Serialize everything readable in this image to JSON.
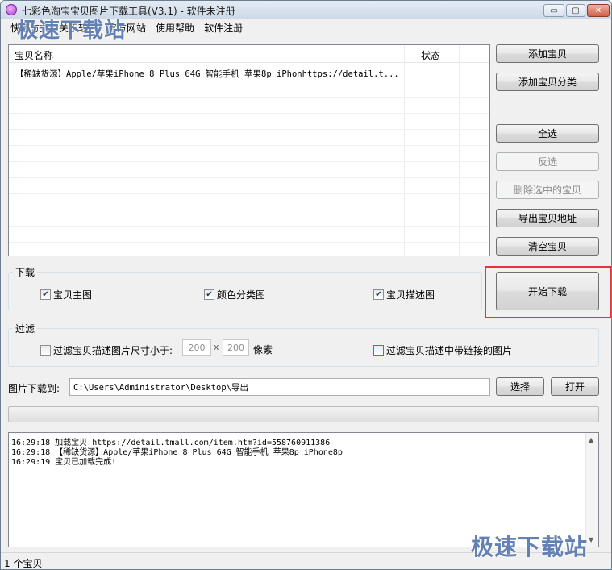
{
  "window": {
    "title": "七彩色淘宝宝贝图片下载工具(V3.1) - 软件未注册",
    "controls": {
      "minimize": "▭",
      "maximize": "▢",
      "close": "✕"
    }
  },
  "menu": {
    "items": [
      "快速方式",
      "关于软件",
      "官方网站",
      "使用帮助",
      "软件注册"
    ]
  },
  "watermark": {
    "top_left": "极速下载站",
    "bottom_right": "极速下载站"
  },
  "list": {
    "columns": [
      "宝贝名称",
      "状态"
    ],
    "rows": [
      {
        "name": "【稀缺货源】Apple/苹果iPhone 8 Plus 64G 智能手机 苹果8p iPhonhttps://detail.t...",
        "status": ""
      }
    ]
  },
  "actions": {
    "add_item": "添加宝贝",
    "add_category": "添加宝贝分类",
    "select_all": "全选",
    "invert_selection": "反选",
    "delete_selected": "删除选中的宝贝",
    "export_urls": "导出宝贝地址",
    "clear_items": "清空宝贝",
    "start_download": "开始下载"
  },
  "download_group": {
    "label": "下载",
    "options": [
      {
        "label": "宝贝主图",
        "checked": true
      },
      {
        "label": "颜色分类图",
        "checked": true
      },
      {
        "label": "宝贝描述图",
        "checked": true
      }
    ]
  },
  "filter_group": {
    "label": "过滤",
    "size_filter": {
      "label": "过滤宝贝描述图片尺寸小于:",
      "checked": false
    },
    "width_placeholder": "200",
    "times": "x",
    "height_placeholder": "200",
    "unit": "像素",
    "link_filter": {
      "label": "过滤宝贝描述中带链接的图片",
      "checked": false
    }
  },
  "save_path": {
    "label": "图片下载到:",
    "value": "C:\\Users\\Administrator\\Desktop\\导出",
    "choose": "选择",
    "open": "打开"
  },
  "log": {
    "lines": [
      "16:29:18 加载宝贝 https://detail.tmall.com/item.htm?id=558760911386",
      "16:29:18 【稀缺货源】Apple/苹果iPhone 8 Plus 64G 智能手机 苹果8p iPhone8p",
      "16:29:19 宝贝已加载完成!"
    ]
  },
  "status_bar": {
    "count": "1 个宝贝"
  },
  "colors": {
    "highlight": "#e0383a",
    "watermark": "#2850a0"
  }
}
